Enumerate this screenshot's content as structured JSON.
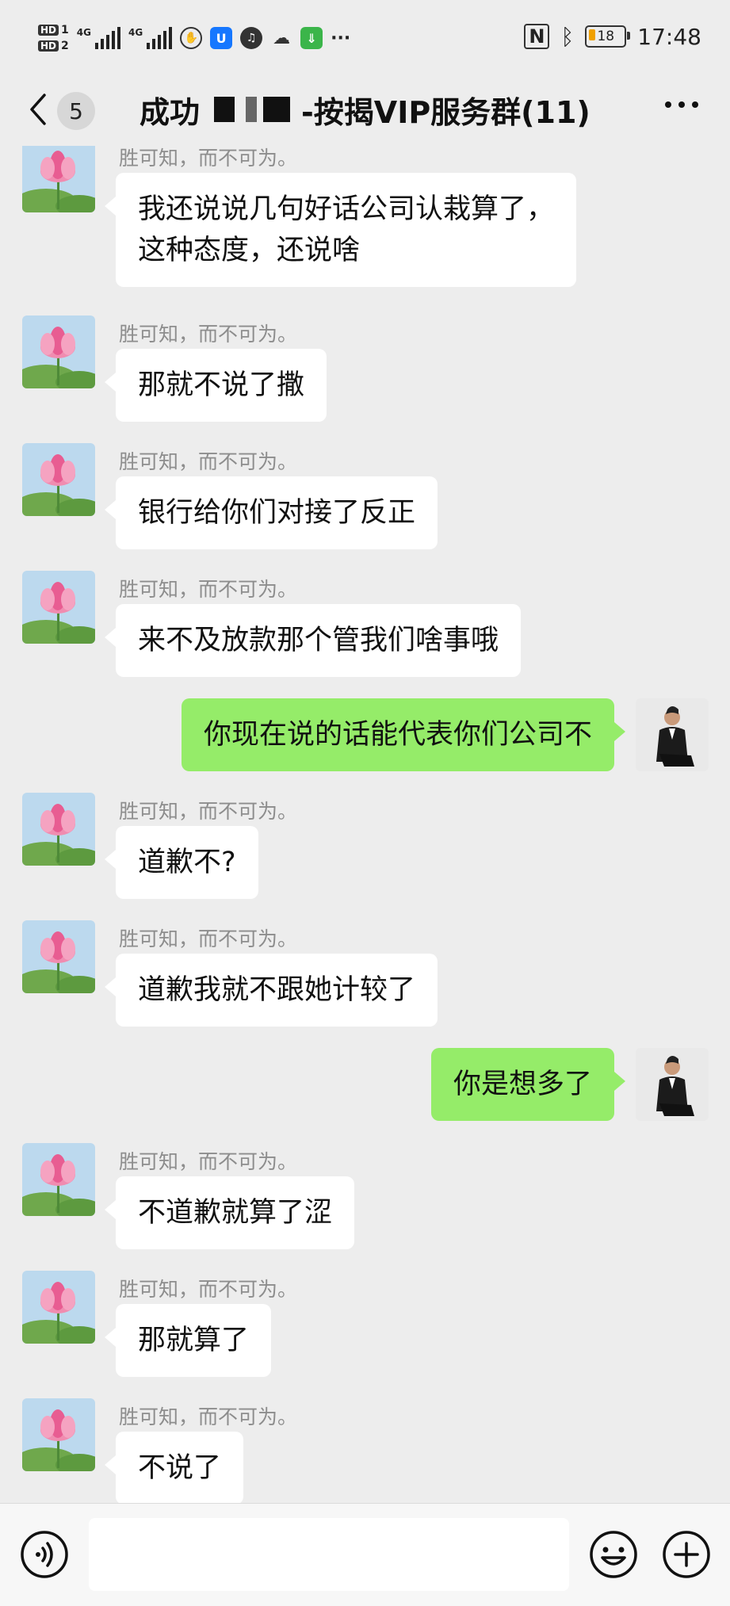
{
  "status_bar": {
    "hd1": "HD",
    "hd1_num": "1",
    "hd2": "HD",
    "hd2_num": "2",
    "net1": "4G",
    "net2": "4G",
    "more": "···",
    "battery": "18",
    "time": "17:48"
  },
  "nav": {
    "badge": "5",
    "title_prefix": "成功",
    "title_suffix": "-按揭VIP服务群(11)"
  },
  "messages": [
    {
      "dir": "in",
      "sender": "胜可知，而不可为。",
      "lines": [
        "我还说说几句好话公司认栽算了，",
        "这种态度，还说啥"
      ]
    },
    {
      "dir": "in",
      "sender": "胜可知，而不可为。",
      "lines": [
        "那就不说了撒"
      ]
    },
    {
      "dir": "in",
      "sender": "胜可知，而不可为。",
      "lines": [
        "银行给你们对接了反正"
      ]
    },
    {
      "dir": "in",
      "sender": "胜可知，而不可为。",
      "lines": [
        "来不及放款那个管我们啥事哦"
      ]
    },
    {
      "dir": "out",
      "lines": [
        "你现在说的话能代表你们公司不"
      ]
    },
    {
      "dir": "in",
      "sender": "胜可知，而不可为。",
      "lines": [
        "道歉不?"
      ]
    },
    {
      "dir": "in",
      "sender": "胜可知，而不可为。",
      "lines": [
        "道歉我就不跟她计较了"
      ]
    },
    {
      "dir": "out",
      "lines": [
        "你是想多了"
      ]
    },
    {
      "dir": "in",
      "sender": "胜可知，而不可为。",
      "lines": [
        "不道歉就算了涩"
      ]
    },
    {
      "dir": "in",
      "sender": "胜可知，而不可为。",
      "lines": [
        "那就算了"
      ]
    },
    {
      "dir": "in",
      "sender": "胜可知，而不可为。",
      "lines": [
        "不说了"
      ]
    }
  ],
  "input": {
    "value": ""
  },
  "icons": {
    "back": "chevron-left-icon",
    "more": "more-dots-icon",
    "voice": "voice-icon",
    "emoji": "emoji-icon",
    "plus": "plus-icon"
  },
  "colors": {
    "background": "#ededed",
    "incoming_bubble": "#ffffff",
    "outgoing_bubble": "#95ec69"
  }
}
